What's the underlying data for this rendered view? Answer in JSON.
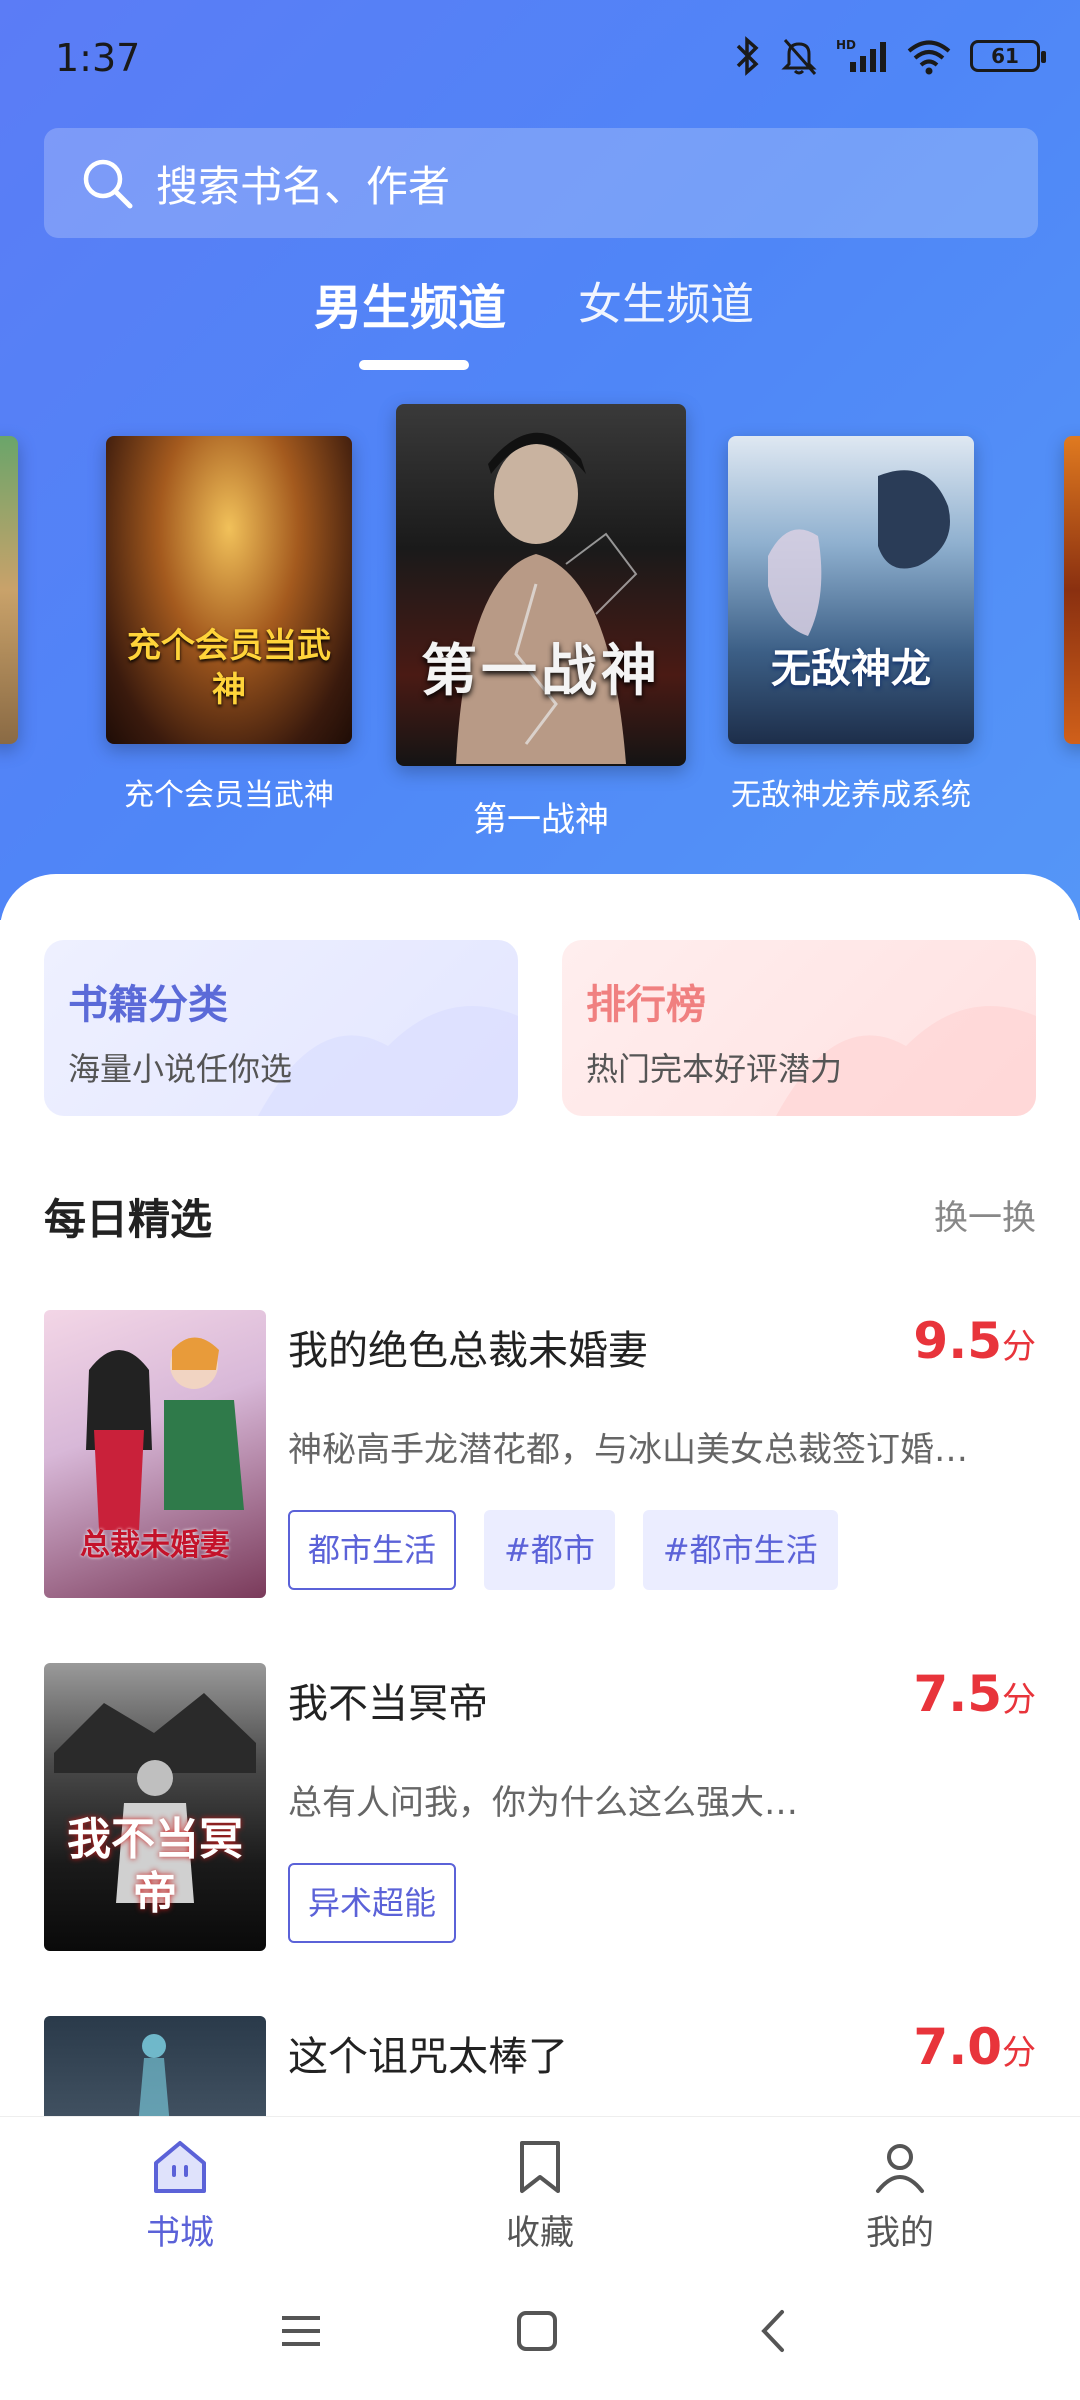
{
  "status_bar": {
    "time": "1:37",
    "battery": "61"
  },
  "search": {
    "placeholder": "搜索书名、作者"
  },
  "channels": {
    "male": "男生频道",
    "female": "女生频道"
  },
  "carousel": {
    "items": [
      {
        "title": "充个会员当武神",
        "cover_text": "充个会员当武神"
      },
      {
        "title": "第一战神",
        "cover_text": "第一战神"
      },
      {
        "title": "无敌神龙养成系统",
        "cover_text": "无敌神龙"
      }
    ]
  },
  "cards": {
    "category": {
      "title": "书籍分类",
      "subtitle": "海量小说任你选"
    },
    "ranking": {
      "title": "排行榜",
      "subtitle": "热门完本好评潜力"
    }
  },
  "daily": {
    "title": "每日精选",
    "action": "换一换",
    "books": [
      {
        "title": "我的绝色总裁未婚妻",
        "score": "9.5",
        "unit": "分",
        "desc": "神秘高手龙潜花都，与冰山美女总裁签订婚…",
        "tags": [
          "都市生活",
          "#都市",
          "#都市生活"
        ],
        "cover_text": "总裁未婚妻"
      },
      {
        "title": "我不当冥帝",
        "score": "7.5",
        "unit": "分",
        "desc": "总有人问我，你为什么这么强大…",
        "tags": [
          "异术超能"
        ],
        "cover_text": "我不当冥帝"
      },
      {
        "title": "这个诅咒太棒了",
        "score": "7.0",
        "unit": "分"
      }
    ]
  },
  "bottom_nav": {
    "home": "书城",
    "favorites": "收藏",
    "profile": "我的"
  },
  "colors": {
    "accent": "#5b62d8",
    "score": "#e8343b",
    "hero_start": "#5b7cf6",
    "hero_end": "#5596f7"
  }
}
